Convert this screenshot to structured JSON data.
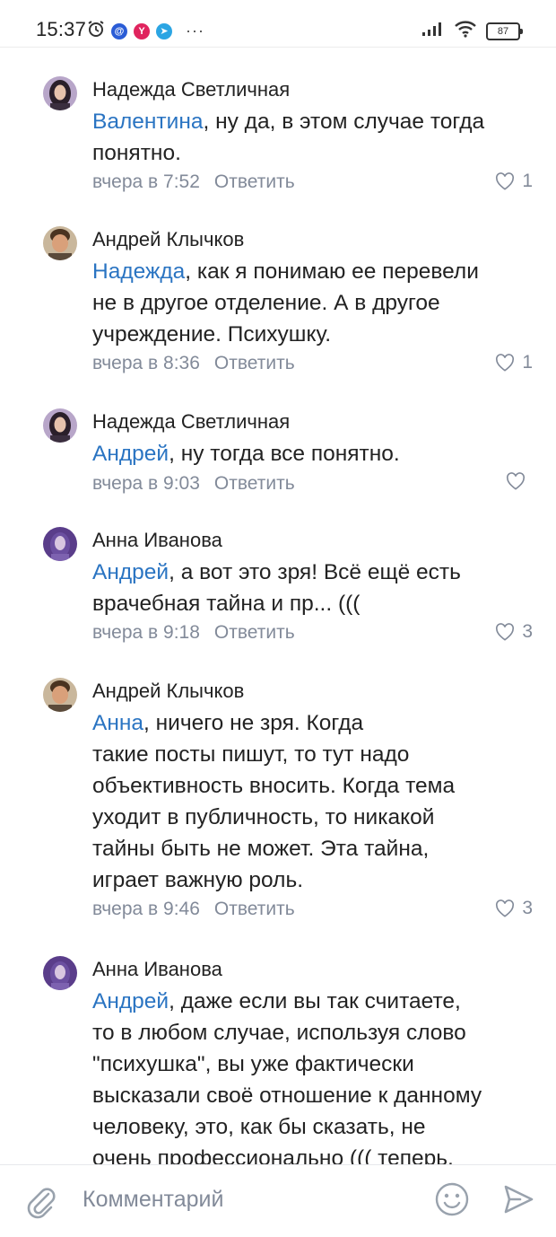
{
  "status_bar": {
    "time": "15:37",
    "battery": "87",
    "icons": [
      "alarm-icon",
      "mail-app-icon",
      "yandex-app-icon",
      "telegram-icon",
      "more-icon",
      "signal-icon",
      "wifi-icon",
      "battery-icon"
    ]
  },
  "colors": {
    "mention": "#2a74c2",
    "meta": "#828a99",
    "text": "#222222"
  },
  "comments": [
    {
      "author": "Надежда Светличная",
      "mention": "Валентина",
      "lines": [
        ", ну да, в этом случае тогда",
        "понятно."
      ],
      "time": "вчера в 7:52",
      "reply": "Ответить",
      "likes": "1"
    },
    {
      "author": "Андрей Клычков",
      "mention": "Надежда",
      "lines": [
        ", как я понимаю ее перевели",
        "не в другое отделение. А в другое",
        "учреждение. Психушку."
      ],
      "time": "вчера в 8:36",
      "reply": "Ответить",
      "likes": "1"
    },
    {
      "author": "Надежда Светличная",
      "mention": "Андрей",
      "lines": [
        ", ну тогда все понятно."
      ],
      "time": "вчера в 9:03",
      "reply": "Ответить",
      "likes": ""
    },
    {
      "author": "Анна Иванова",
      "mention": "Андрей",
      "lines": [
        ", а вот это зря! Всё ещё есть",
        "врачебная тайна и пр... ((("
      ],
      "time": "вчера в 9:18",
      "reply": "Ответить",
      "likes": "3"
    },
    {
      "author": "Андрей Клычков",
      "mention": "Анна",
      "lines": [
        ", ничего не зря. Когда",
        "такие посты пишут, то тут надо",
        "объективность вносить. Когда тема",
        "уходит в публичность, то никакой",
        "тайны быть не может. Эта тайна,",
        "играет важную роль."
      ],
      "time": "вчера в 9:46",
      "reply": "Ответить",
      "likes": "3"
    },
    {
      "author": "Анна Иванова",
      "mention": "Андрей",
      "lines": [
        ", даже если вы так считаете,",
        "то в любом случае, используя слово",
        "\"психушка\", вы уже фактически",
        "высказали своё отношение к данному",
        "человеку, это, как бы сказать, не",
        "очень профессионально ((( теперь,"
      ],
      "time": "",
      "reply": "",
      "likes": ""
    }
  ],
  "composer": {
    "placeholder": "Комментарий"
  }
}
